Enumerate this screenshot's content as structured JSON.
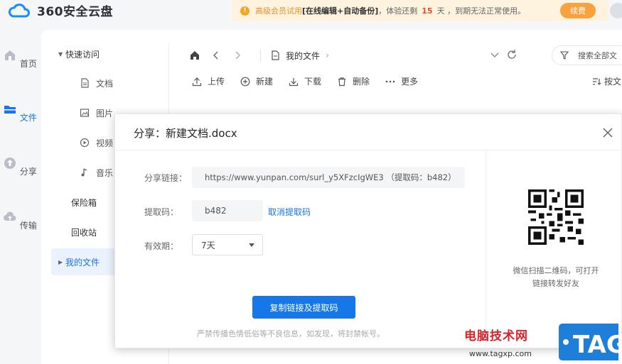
{
  "app": {
    "logo_text": "360安全云盘"
  },
  "notice": {
    "part1": "高级会员试用",
    "part2": "[在线编辑+自动备份]",
    "part3": "，体验还剩",
    "days": "15",
    "part4": "天 ，到期无法正常使用。",
    "renew_label": "续费"
  },
  "leftnav": {
    "items": [
      {
        "label": "首页",
        "icon": "home-icon"
      },
      {
        "label": "文件",
        "icon": "folder-icon"
      },
      {
        "label": "分享",
        "icon": "share-icon"
      },
      {
        "label": "传输",
        "icon": "transfer-icon"
      }
    ]
  },
  "tree": {
    "quick_access": "快速访问",
    "docs": "文档",
    "images": "图片",
    "videos": "视频",
    "music": "音乐",
    "safe": "保险箱",
    "recycle": "回收站",
    "my_files": "我的文件"
  },
  "breadcrumb": {
    "current": "我的文件"
  },
  "search": {
    "placeholder": "搜索全部文"
  },
  "toolbar": {
    "upload": "上传",
    "new": "新建",
    "download": "下载",
    "delete": "删除",
    "more": "更多",
    "sort": "按文"
  },
  "dialog": {
    "title": "分享：新建文档.docx",
    "link_label": "分享链接：",
    "link_value": "https://www.yunpan.com/surl_y5XFzcIgWE3 （提取码：b482）",
    "code_label": "提取码：",
    "code_value": "b482",
    "cancel_code": "取消提取码",
    "validity_label": "有效期：",
    "validity_value": "7天",
    "copy_button": "复制链接及提取码",
    "warning": "严禁传播色情低俗等不良信息，如发现，将封禁帐号。",
    "qr_hint_line1": "微信扫描二维码，可打开",
    "qr_hint_line2": "链接转发好友"
  },
  "watermark": {
    "site_name": "电脑技术网",
    "url": "www.tagxp.com",
    "tag": "TAG"
  },
  "colors": {
    "accent": "#1677e8",
    "renew": "#f7a23d",
    "notice_bg": "#fdf3df",
    "watermark_red": "#d9232b"
  }
}
